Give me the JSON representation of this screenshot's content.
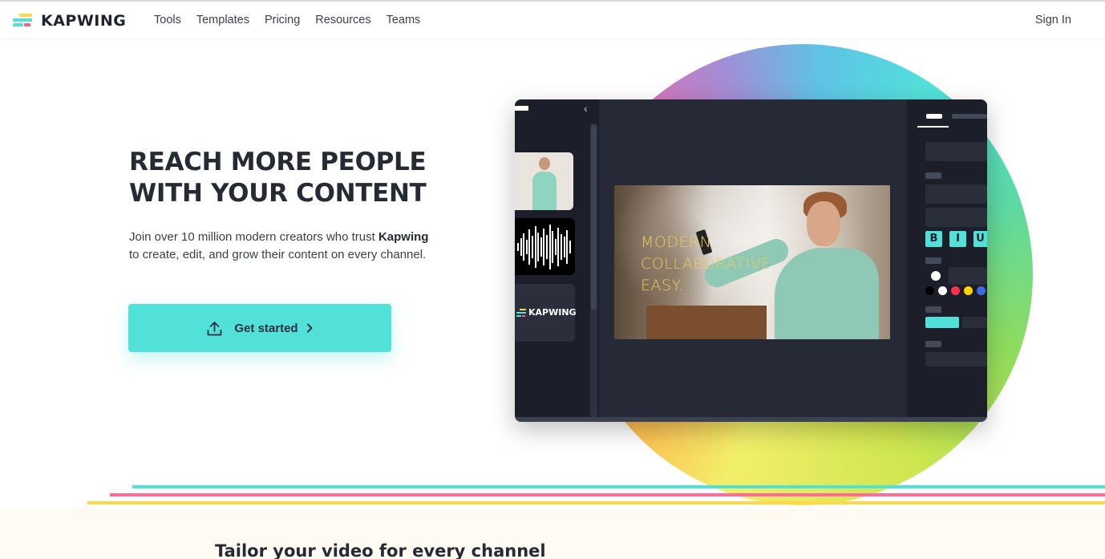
{
  "brand": {
    "name": "KAPWING"
  },
  "nav": {
    "links": [
      "Tools",
      "Templates",
      "Pricing",
      "Resources",
      "Teams"
    ],
    "signin": "Sign In"
  },
  "hero": {
    "title_line1": "REACH MORE PEOPLE",
    "title_line2": "WITH YOUR CONTENT",
    "sub_before": "Join over 10 million modern creators who trust ",
    "sub_brand": "Kapwing",
    "sub_after": " to create, edit, and grow their content on every channel.",
    "cta_label": "Get started"
  },
  "editor_mock": {
    "thumbnail_logo_text": "KAPWING",
    "canvas_caption": [
      "MODERN.",
      "COLLABORATIVE.",
      "EASY."
    ],
    "format_buttons": [
      "B",
      "I",
      "U"
    ],
    "swatch_colors": [
      "#000000",
      "#ffffff",
      "#ff2e4f",
      "#ffd400",
      "#3b6fe0"
    ]
  },
  "colors": {
    "accent": "#52e1d9",
    "pink": "#ff6b98",
    "yellow": "#ffd84a",
    "dark": "#262a36"
  },
  "section2": {
    "title": "Tailor your video for every channel"
  }
}
